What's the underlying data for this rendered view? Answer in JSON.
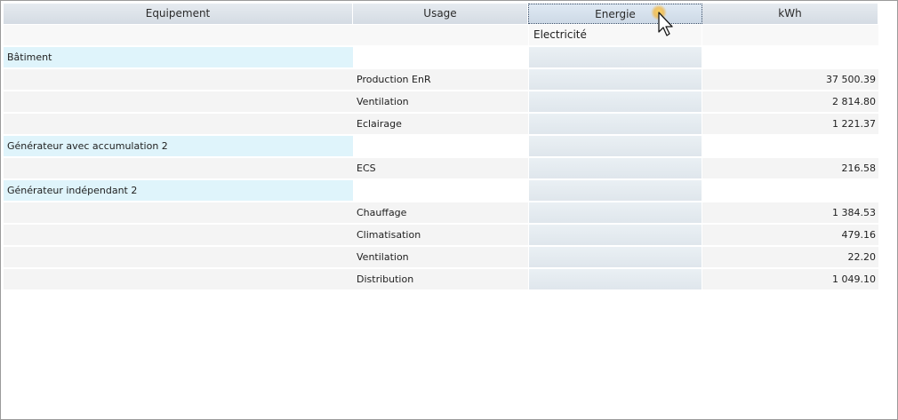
{
  "columns": {
    "equipement": "Equipement",
    "usage": "Usage",
    "energie": "Energie",
    "kwh": "kWh"
  },
  "energy_row": {
    "energie": "Electricité"
  },
  "rows": [
    {
      "equipement": "Bâtiment",
      "usage": "",
      "kwh": ""
    },
    {
      "equipement": "",
      "usage": "Production EnR",
      "kwh": "37 500.39"
    },
    {
      "equipement": "",
      "usage": "Ventilation",
      "kwh": "2 814.80"
    },
    {
      "equipement": "",
      "usage": "Eclairage",
      "kwh": "1 221.37"
    },
    {
      "equipement": "Générateur avec accumulation 2",
      "usage": "",
      "kwh": ""
    },
    {
      "equipement": "",
      "usage": "ECS",
      "kwh": "216.58"
    },
    {
      "equipement": "Générateur indépendant 2",
      "usage": "",
      "kwh": ""
    },
    {
      "equipement": "",
      "usage": "Chauffage",
      "kwh": "1 384.53"
    },
    {
      "equipement": "",
      "usage": "Climatisation",
      "kwh": "479.16"
    },
    {
      "equipement": "",
      "usage": "Ventilation",
      "kwh": "22.20"
    },
    {
      "equipement": "",
      "usage": "Distribution",
      "kwh": "1 049.10"
    }
  ],
  "icons": {
    "cursor": "mouse-pointer-icon"
  },
  "colors": {
    "header": "#dbe1e8",
    "group_row": "#dff4fb",
    "energy_column": "#e4eaef"
  }
}
